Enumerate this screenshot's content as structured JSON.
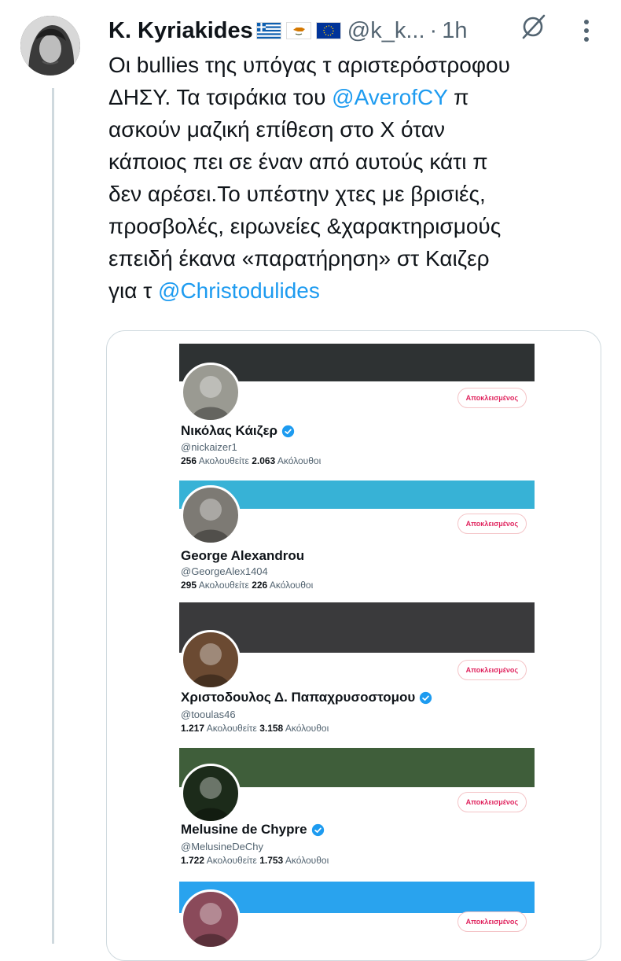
{
  "tweet": {
    "author_name": "K. Kyriakides",
    "flags": [
      "greece-flag",
      "cyprus-flag",
      "eu-flag"
    ],
    "handle": "@k_k...",
    "separator": "·",
    "time": "1h",
    "text_lines": [
      {
        "parts": [
          {
            "text": "Οι bullies της υπόγας τ αριστερόστροφου",
            "mention": false
          }
        ]
      },
      {
        "parts": [
          {
            "text": "ΔΗΣΥ. Τα τσιράκια του ",
            "mention": false
          },
          {
            "text": "@AverofCY",
            "mention": true
          },
          {
            "text": " π",
            "mention": false
          }
        ]
      },
      {
        "parts": [
          {
            "text": "ασκούν μαζική επίθεση στο Χ όταν",
            "mention": false
          }
        ]
      },
      {
        "parts": [
          {
            "text": "κάποιος πει σε έναν από αυτούς κάτι π",
            "mention": false
          }
        ]
      },
      {
        "parts": [
          {
            "text": "δεν αρέσει.Το υπέστην χτες με βρισιές,",
            "mention": false
          }
        ]
      },
      {
        "parts": [
          {
            "text": "προσβολές, ειρωνείες &χαρακτηρισμούς",
            "mention": false
          }
        ]
      },
      {
        "parts": [
          {
            "text": "επειδή έκανα «παρατήρηση» στ Καιζερ",
            "mention": false
          }
        ]
      },
      {
        "parts": [
          {
            "text": "για τ ",
            "mention": false
          },
          {
            "text": "@Christodulides",
            "mention": true
          }
        ]
      }
    ]
  },
  "profiles": [
    {
      "name": "Νικόλας Κάιζερ",
      "verified": true,
      "handle": "@nickaizer1",
      "following": "256",
      "following_label": "Ακολουθείτε",
      "followers": "2.063",
      "followers_label": "Ακόλουθοι",
      "button": "Αποκλεισμένος",
      "banner_color": "#2e3233",
      "avatar_color": "#9a9a92"
    },
    {
      "name": "George Alexandrou",
      "verified": false,
      "handle": "@GeorgeAlex1404",
      "following": "295",
      "following_label": "Ακολουθείτε",
      "followers": "226",
      "followers_label": "Ακόλουθοι",
      "button": "Αποκλεισμένος",
      "banner_color": "#37b2d6",
      "avatar_color": "#7d7a74"
    },
    {
      "name": "Χριστοδουλος Δ. Παπαχρυσοστομου",
      "verified": true,
      "handle": "@tooulas46",
      "following": "1.217",
      "following_label": "Ακολουθείτε",
      "followers": "3.158",
      "followers_label": "Ακόλουθοι",
      "button": "Αποκλεισμένος",
      "banner_color": "#3a3a3c",
      "avatar_color": "#6b4a32"
    },
    {
      "name": "Melusine de Chypre",
      "verified": true,
      "handle": "@MelusineDeChy",
      "following": "1.722",
      "following_label": "Ακολουθείτε",
      "followers": "1.753",
      "followers_label": "Ακόλουθοι",
      "button": "Αποκλεισμένος",
      "banner_color": "#3f5e3a",
      "avatar_color": "#1c2b1a"
    },
    {
      "name": "",
      "verified": false,
      "handle": "",
      "following": "",
      "following_label": "",
      "followers": "",
      "followers_label": "",
      "button": "Αποκλεισμένος",
      "banner_color": "#29a3ee",
      "avatar_color": "#8a4a5a"
    }
  ],
  "colors": {
    "accent": "#1d9bf0",
    "blocked": "#e0245e",
    "muted": "#536471",
    "text": "#0f1419"
  }
}
